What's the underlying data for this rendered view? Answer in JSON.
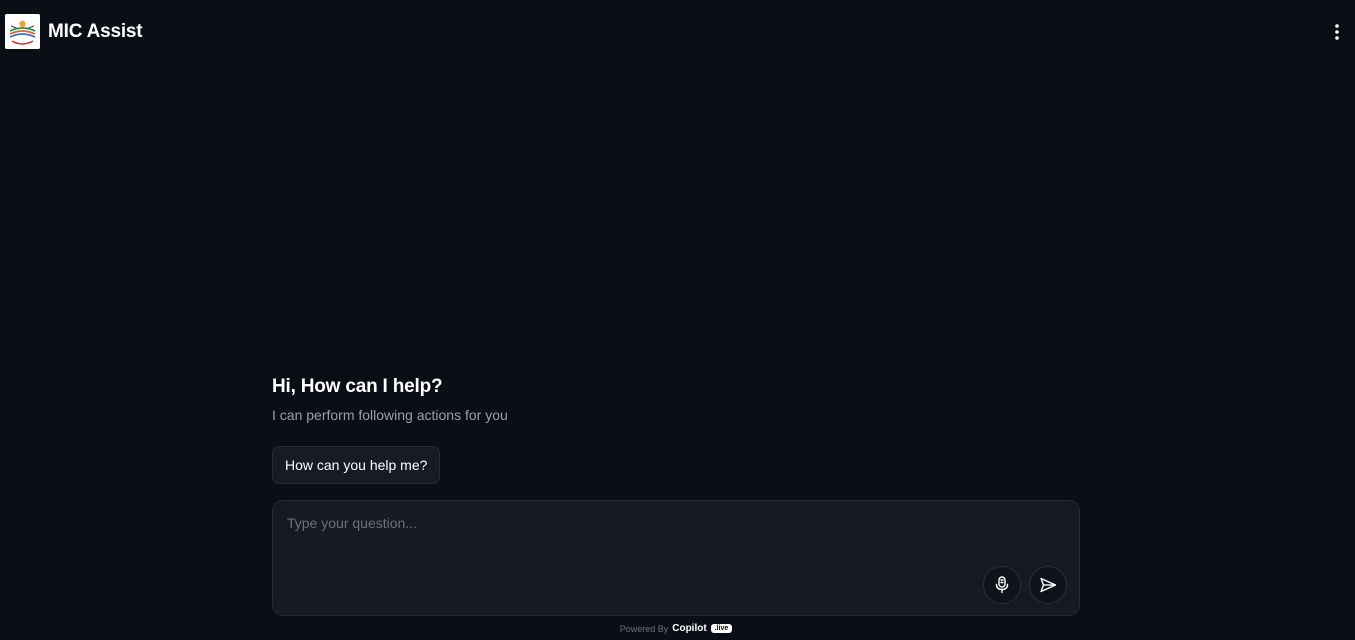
{
  "header": {
    "title": "MIC Assist",
    "logo_icon": "mic-logo-icon",
    "menu_icon": "more-vertical-icon"
  },
  "welcome": {
    "greeting": "Hi, How can I help?",
    "subtitle": "I can perform following actions for you",
    "suggestions": [
      "How can you help me?"
    ]
  },
  "composer": {
    "placeholder": "Type your question...",
    "value": "",
    "mic_icon": "microphone-icon",
    "send_icon": "send-icon"
  },
  "footer": {
    "powered_by": "Powered By",
    "brand": "Copilot",
    "tag": ".live"
  },
  "colors": {
    "background": "#0a0e17",
    "surface": "#151a24",
    "border": "#252b36",
    "text": "#ffffff",
    "muted": "#9aa0aa"
  }
}
